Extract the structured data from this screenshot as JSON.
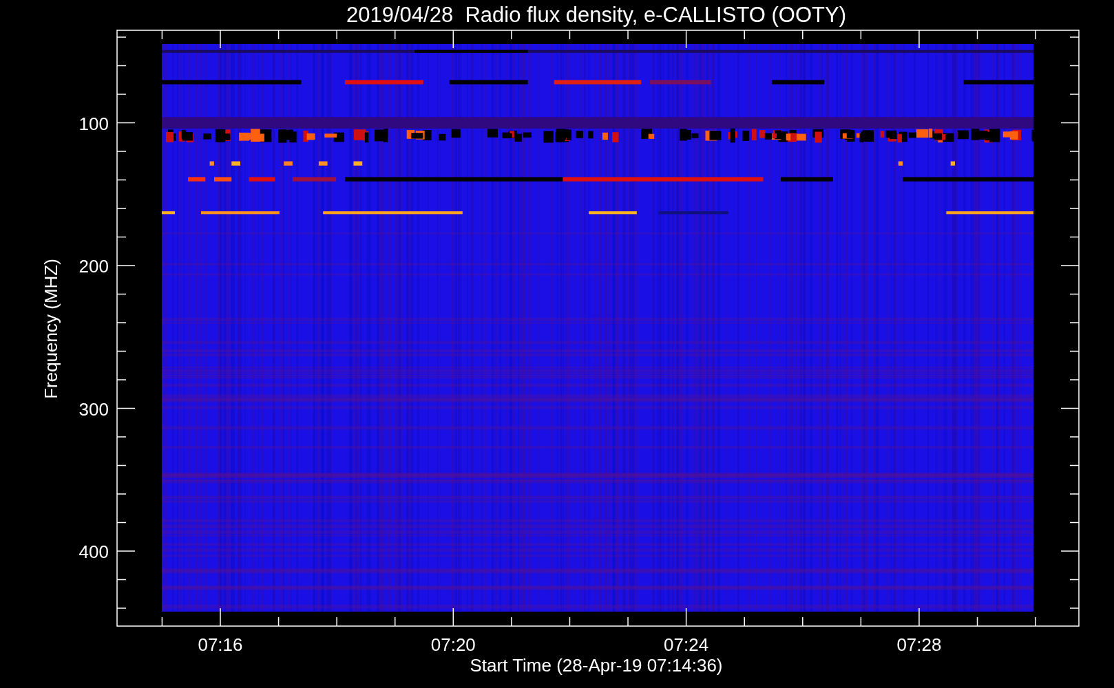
{
  "title": "2019/04/28  Radio flux density, e-CALLISTO (OOTY)",
  "y_axis": {
    "label": "Frequency (MHZ)",
    "ticks": [
      "100",
      "200",
      "300",
      "400"
    ]
  },
  "x_axis": {
    "label": "Start Time (28-Apr-19 07:14:36)",
    "ticks": [
      "07:16",
      "07:20",
      "07:24",
      "07:28"
    ]
  }
}
